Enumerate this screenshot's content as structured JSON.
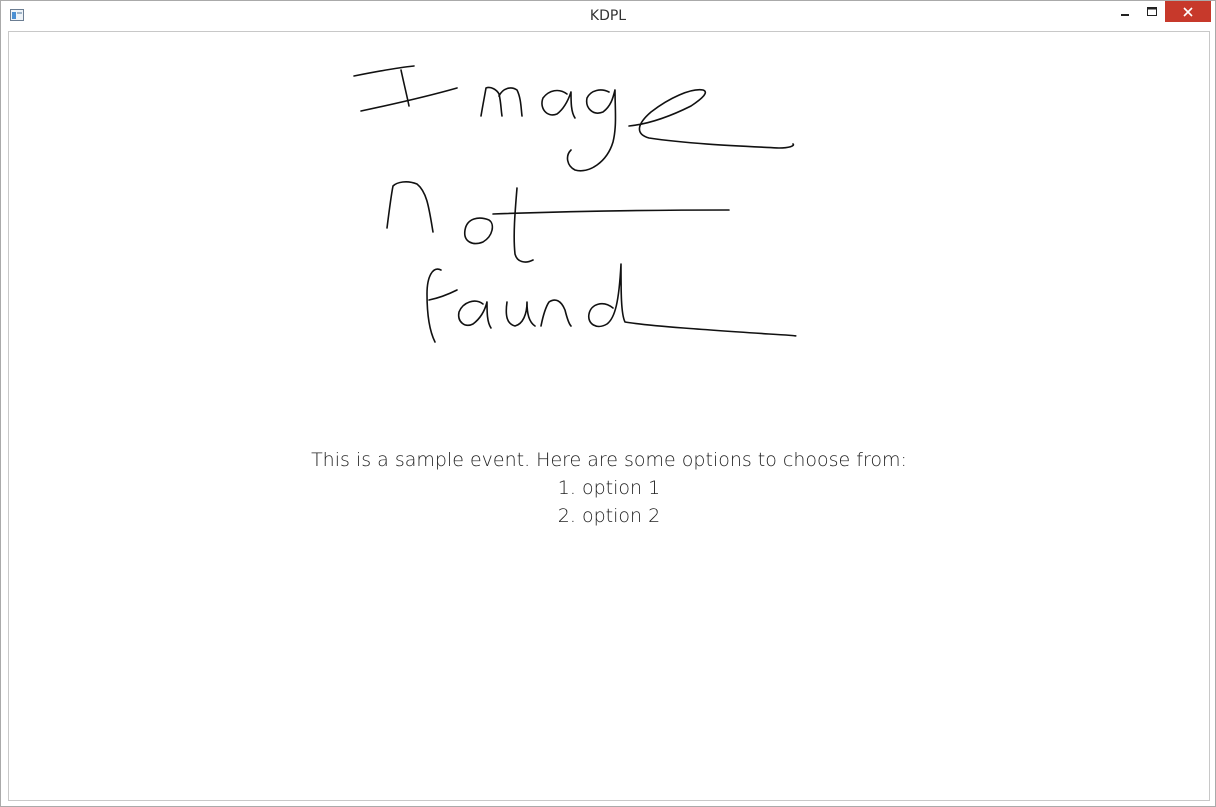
{
  "window": {
    "title": "KDPL",
    "icon": "app-window-icon",
    "controls": [
      "minimize-icon",
      "maximize-icon",
      "close-icon"
    ],
    "close_color": "#c7392b"
  },
  "event": {
    "image_text": "Image not found",
    "prompt": "This is a sample event. Here are some options to choose from:",
    "options": [
      "1. option 1",
      "2. option 2"
    ]
  }
}
